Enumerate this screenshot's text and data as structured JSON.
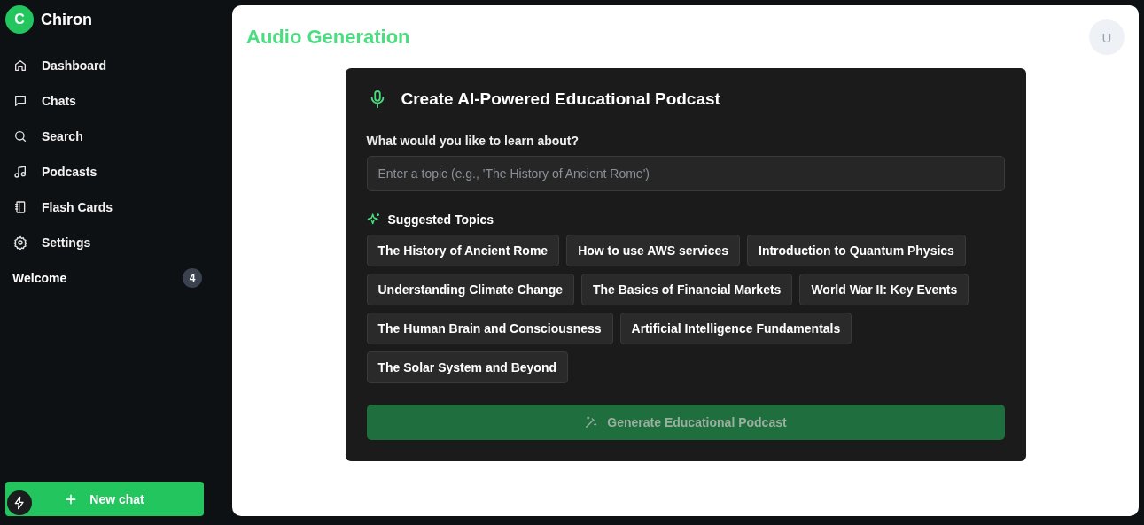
{
  "brand": {
    "initial": "C",
    "name": "Chiron"
  },
  "nav": [
    {
      "label": "Dashboard"
    },
    {
      "label": "Chats"
    },
    {
      "label": "Search"
    },
    {
      "label": "Podcasts"
    },
    {
      "label": "Flash Cards"
    },
    {
      "label": "Settings"
    }
  ],
  "section": {
    "label": "Welcome",
    "count": "4"
  },
  "new_chat": {
    "label": "New chat"
  },
  "page_title": "Audio Generation",
  "avatar": "U",
  "card": {
    "title": "Create AI-Powered Educational Podcast",
    "field_label": "What would you like to learn about?",
    "topic_field": {
      "placeholder": "Enter a topic (e.g., 'The History of Ancient Rome')"
    },
    "suggested_heading": "Suggested Topics",
    "topics": [
      "The History of Ancient Rome",
      "How to use AWS services",
      "Introduction to Quantum Physics",
      "Understanding Climate Change",
      "The Basics of Financial Markets",
      "World War II: Key Events",
      "The Human Brain and Consciousness",
      "Artificial Intelligence Fundamentals",
      "The Solar System and Beyond"
    ],
    "generate_button": {
      "label": "Generate Educational Podcast",
      "disabled": true
    }
  }
}
